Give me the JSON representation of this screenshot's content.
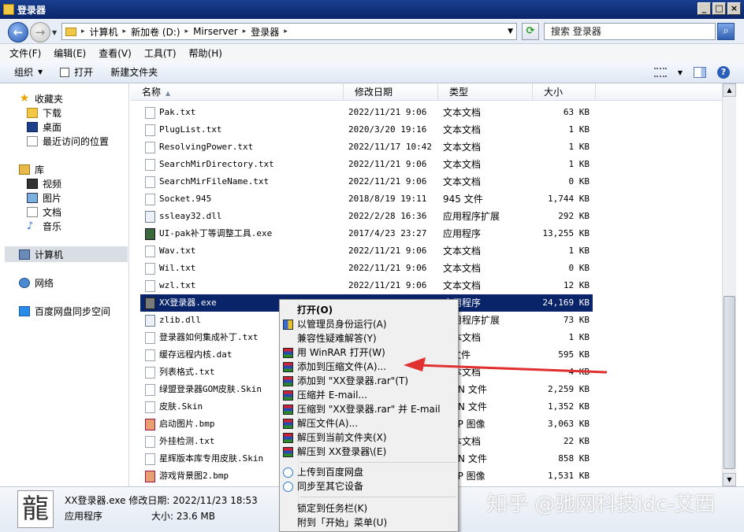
{
  "window": {
    "title": "登录器"
  },
  "address": {
    "crumbs": [
      "计算机",
      "新加卷 (D:)",
      "Mirserver",
      "登录器"
    ],
    "search_placeholder": "搜索 登录器"
  },
  "menubar": [
    "文件(F)",
    "编辑(E)",
    "查看(V)",
    "工具(T)",
    "帮助(H)"
  ],
  "toolbar": {
    "organize": "组织",
    "open": "打开",
    "new_folder": "新建文件夹"
  },
  "nav": {
    "favorites": "收藏夹",
    "downloads": "下载",
    "desktop": "桌面",
    "recent": "最近访问的位置",
    "libraries": "库",
    "videos": "视频",
    "pictures": "图片",
    "documents": "文档",
    "music": "音乐",
    "computer": "计算机",
    "network": "网络",
    "baidu": "百度网盘同步空间"
  },
  "columns": {
    "name": "名称",
    "date": "修改日期",
    "type": "类型",
    "size": "大小"
  },
  "files": [
    {
      "name": "Pak.txt",
      "date": "2022/11/21 9:06",
      "type": "文本文档",
      "size": "63 KB",
      "icon": "txt"
    },
    {
      "name": "PlugList.txt",
      "date": "2020/3/20 19:16",
      "type": "文本文档",
      "size": "1 KB",
      "icon": "txt"
    },
    {
      "name": "ResolvingPower.txt",
      "date": "2022/11/17 10:42",
      "type": "文本文档",
      "size": "1 KB",
      "icon": "txt"
    },
    {
      "name": "SearchMirDirectory.txt",
      "date": "2022/11/21 9:06",
      "type": "文本文档",
      "size": "1 KB",
      "icon": "txt"
    },
    {
      "name": "SearchMirFileName.txt",
      "date": "2022/11/21 9:06",
      "type": "文本文档",
      "size": "0 KB",
      "icon": "txt"
    },
    {
      "name": "Socket.945",
      "date": "2018/8/19 19:11",
      "type": "945 文件",
      "size": "1,744 KB",
      "icon": "txt"
    },
    {
      "name": "ssleay32.dll",
      "date": "2022/2/28 16:36",
      "type": "应用程序扩展",
      "size": "292 KB",
      "icon": "dll"
    },
    {
      "name": "UI-pak补丁等调整工具.exe",
      "date": "2017/4/23 23:27",
      "type": "应用程序",
      "size": "13,255 KB",
      "icon": "exe"
    },
    {
      "name": "Wav.txt",
      "date": "2022/11/21 9:06",
      "type": "文本文档",
      "size": "1 KB",
      "icon": "txt"
    },
    {
      "name": "Wil.txt",
      "date": "2022/11/21 9:06",
      "type": "文本文档",
      "size": "0 KB",
      "icon": "txt"
    },
    {
      "name": "wzl.txt",
      "date": "2022/11/21 9:06",
      "type": "文本文档",
      "size": "12 KB",
      "icon": "txt"
    },
    {
      "name": "XX登录器.exe",
      "date": "",
      "type": "应用程序",
      "size": "24,169 KB",
      "icon": "exe2",
      "selected": true
    },
    {
      "name": "zlib.dll",
      "date": "",
      "type": "应用程序扩展",
      "size": "73 KB",
      "icon": "dll"
    },
    {
      "name": "登录器如何集成补丁.txt",
      "date": "",
      "type": "文本文档",
      "size": "1 KB",
      "icon": "txt"
    },
    {
      "name": "缓存远程内核.dat",
      "date": "",
      "type": "T 文件",
      "size": "595 KB",
      "icon": "txt"
    },
    {
      "name": "列表格式.txt",
      "date": "",
      "type": "文本文档",
      "size": "4 KB",
      "icon": "txt"
    },
    {
      "name": "绿盟登录器GOM皮肤.Skin",
      "date": "",
      "type": "SKIN 文件",
      "size": "2,259 KB",
      "icon": "txt"
    },
    {
      "name": "皮肤.Skin",
      "date": "",
      "type": "SKIN 文件",
      "size": "1,352 KB",
      "icon": "txt"
    },
    {
      "name": "启动图片.bmp",
      "date": "",
      "type": "BMP 图像",
      "size": "3,063 KB",
      "icon": "bmp"
    },
    {
      "name": "外挂检测.txt",
      "date": "",
      "type": "文本文档",
      "size": "22 KB",
      "icon": "txt"
    },
    {
      "name": "星辉版本库专用皮肤.Skin",
      "date": "",
      "type": "SKIN 文件",
      "size": "858 KB",
      "icon": "txt"
    },
    {
      "name": "游戏背景图2.bmp",
      "date": "",
      "type": "BMP 图像",
      "size": "1,531 KB",
      "icon": "bmp"
    }
  ],
  "context_menu": {
    "open": "打开(O)",
    "run_as_admin": "以管理员身份运行(A)",
    "compat": "兼容性疑难解答(Y)",
    "open_winrar": "用 WinRAR 打开(W)",
    "add_archive": "添加到压缩文件(A)...",
    "add_rar": "添加到 \"XX登录器.rar\"(T)",
    "compress_email": "压缩并 E-mail...",
    "compress_rar_email": "压缩到 \"XX登录器.rar\" 并 E-mail",
    "extract": "解压文件(A)...",
    "extract_here": "解压到当前文件夹(X)",
    "extract_to": "解压到 XX登录器\\(E)",
    "upload_baidu": "上传到百度网盘",
    "sync_device": "同步至其它设备",
    "pin_taskbar": "锁定到任务栏(K)",
    "pin_start": "附到「开始」菜单(U)"
  },
  "details": {
    "name_date": "XX登录器.exe 修改日期: 2022/11/23 18:53",
    "type": "应用程序",
    "size": "大小: 23.6 MB",
    "thumb_glyph": "龍"
  },
  "watermark": "知乎 @驰网科技idc-艾西",
  "colors": {
    "selection": "#0a246a",
    "arrow": "#e03030"
  }
}
